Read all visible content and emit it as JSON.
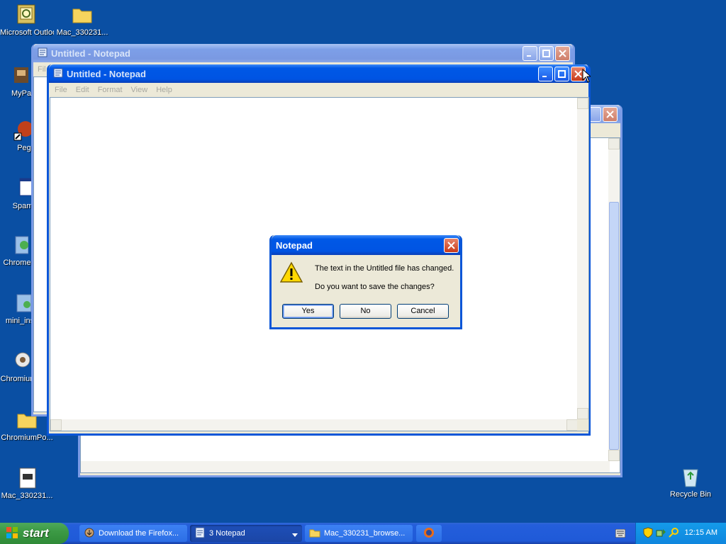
{
  "desktop": {
    "icons": [
      {
        "label": "Microsoft Outlook",
        "icon": "outlook-icon"
      },
      {
        "label": "Mac_330231...",
        "icon": "folder-icon"
      },
      {
        "label": "MyPa",
        "icon": "mypaint-icon"
      },
      {
        "label": "Peg",
        "icon": "pegasus-icon"
      },
      {
        "label": "Spam",
        "icon": "spam-app-icon"
      },
      {
        "label": "Chrome",
        "icon": "chrome-installer-icon"
      },
      {
        "label": "mini_ins",
        "icon": "mini-installer-icon"
      },
      {
        "label": "Chromium",
        "icon": "chromium-icon"
      },
      {
        "label": "ChromiumPo...",
        "icon": "folder-icon"
      },
      {
        "label": "Mac_330231...",
        "icon": "exe-file-icon"
      },
      {
        "label": "Recycle Bin",
        "icon": "recycle-bin-icon"
      }
    ]
  },
  "windows": {
    "back_notepad": {
      "title": "Untitled - Notepad",
      "menu_fragment": "Fil"
    },
    "front_notepad": {
      "title": "Untitled - Notepad",
      "menu": [
        "File",
        "Edit",
        "Format",
        "View",
        "Help"
      ]
    }
  },
  "dialog": {
    "title": "Notepad",
    "line1": "The text in the Untitled file has changed.",
    "line2": "Do you want to save the changes?",
    "buttons": {
      "yes": "Yes",
      "no": "No",
      "cancel": "Cancel"
    },
    "icon": "warning-icon"
  },
  "taskbar": {
    "start_label": "start",
    "tasks": [
      {
        "label": "Download the Firefox...",
        "icon": "firefox-download-icon"
      },
      {
        "label": "3 Notepad",
        "icon": "notepad-icon"
      },
      {
        "label": "Mac_330231_browse...",
        "icon": "folder-icon"
      }
    ],
    "quicklaunch_icon": "firefox-icon",
    "clock": "12:15 AM"
  },
  "colors": {
    "desktop": "#0a4fa3",
    "title_active": "#0054e3",
    "start_green": "#3c9a45"
  }
}
